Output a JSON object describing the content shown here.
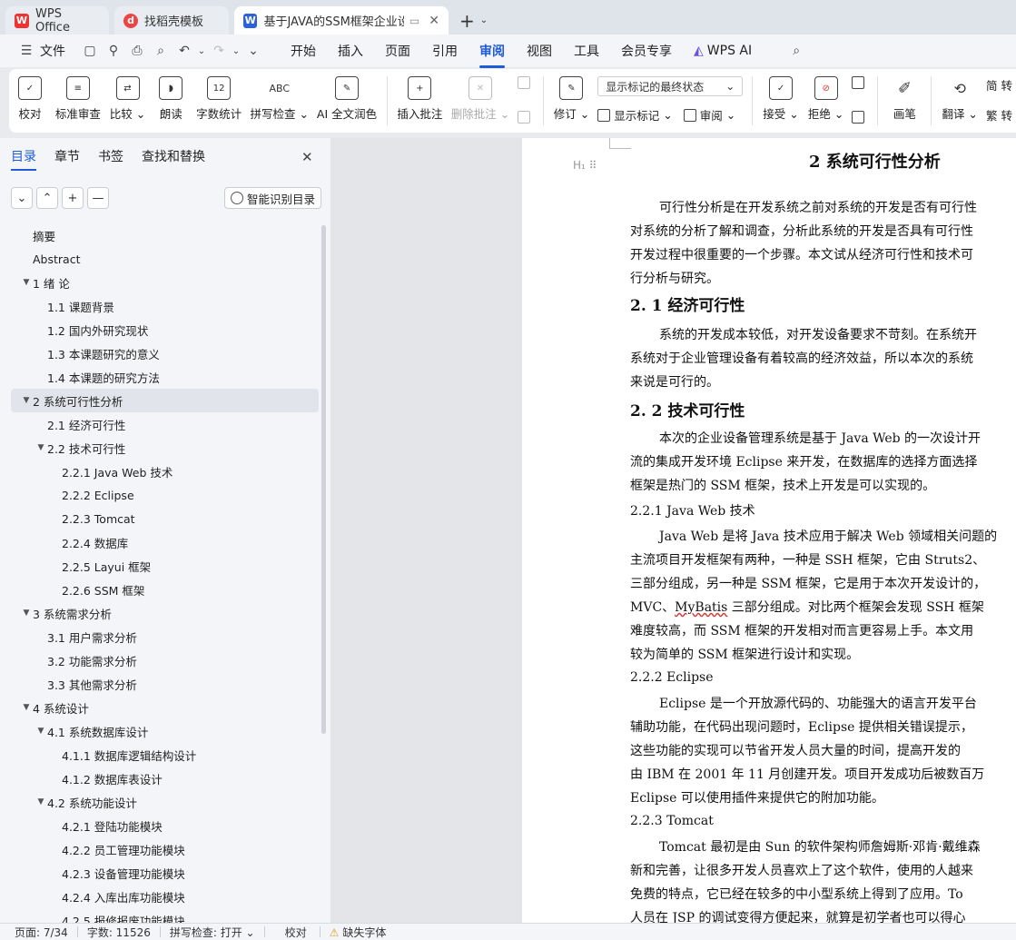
{
  "tabs": [
    {
      "label": "WPS Office",
      "icon": "wps-logo-icon"
    },
    {
      "label": "找稻壳模板",
      "icon": "docer-logo-icon"
    },
    {
      "label": "基于JAVA的SSM框架企业设备",
      "icon": "word-doc-icon"
    }
  ],
  "menubar": {
    "file": "文件",
    "items": [
      "开始",
      "插入",
      "页面",
      "引用",
      "审阅",
      "视图",
      "工具",
      "会员专享"
    ],
    "active": "审阅",
    "wps_ai": "WPS AI"
  },
  "ribbon": {
    "proofread": "校对",
    "std_review": "标准审查",
    "compare": "比较",
    "read_aloud": "朗读",
    "word_count": "字数统计",
    "word_count_icon": "12",
    "spell_check": "拼写检查",
    "spell_icon": "ABC",
    "ai_polish": "AI 全文润色",
    "insert_comment": "插入批注",
    "delete_comment": "删除批注",
    "track_changes": "修订",
    "markup_display": "显示标记的最终状态",
    "show_markup": "显示标记",
    "review": "审阅",
    "accept": "接受",
    "reject": "拒绝",
    "pen": "画笔",
    "translate": "翻译",
    "simp": "简",
    "trad": "繁"
  },
  "nav": {
    "tabs": [
      "目录",
      "章节",
      "书签",
      "查找和替换"
    ],
    "smart_btn": "智能识别目录",
    "toc": [
      {
        "label": "摘要",
        "level": 1,
        "arrow": false
      },
      {
        "label": "Abstract",
        "level": 1,
        "arrow": false
      },
      {
        "label": "1  绪  论",
        "level": 1,
        "arrow": true
      },
      {
        "label": "1.1  课题背景",
        "level": 2,
        "arrow": false
      },
      {
        "label": "1.2  国内外研究现状",
        "level": 2,
        "arrow": false
      },
      {
        "label": "1.3  本课题研究的意义",
        "level": 2,
        "arrow": false
      },
      {
        "label": "1.4  本课题的研究方法",
        "level": 2,
        "arrow": false
      },
      {
        "label": "2  系统可行性分析",
        "level": 1,
        "arrow": true,
        "selected": true
      },
      {
        "label": "2.1  经济可行性",
        "level": 2,
        "arrow": false
      },
      {
        "label": "2.2  技术可行性",
        "level": 2,
        "arrow": true
      },
      {
        "label": "2.2.1 Java Web 技术",
        "level": 3,
        "arrow": false
      },
      {
        "label": "2.2.2 Eclipse",
        "level": 3,
        "arrow": false
      },
      {
        "label": "2.2.3 Tomcat",
        "level": 3,
        "arrow": false
      },
      {
        "label": "2.2.4  数据库",
        "level": 3,
        "arrow": false
      },
      {
        "label": "2.2.5 Layui 框架",
        "level": 3,
        "arrow": false
      },
      {
        "label": "2.2.6 SSM 框架",
        "level": 3,
        "arrow": false
      },
      {
        "label": "3  系统需求分析",
        "level": 1,
        "arrow": true
      },
      {
        "label": "3.1  用户需求分析",
        "level": 2,
        "arrow": false
      },
      {
        "label": "3.2  功能需求分析",
        "level": 2,
        "arrow": false
      },
      {
        "label": "3.3  其他需求分析",
        "level": 2,
        "arrow": false
      },
      {
        "label": "4  系统设计",
        "level": 1,
        "arrow": true
      },
      {
        "label": "4.1  系统数据库设计",
        "level": 2,
        "arrow": true
      },
      {
        "label": "4.1.1  数据库逻辑结构设计",
        "level": 3,
        "arrow": false
      },
      {
        "label": "4.1.2  数据库表设计",
        "level": 3,
        "arrow": false
      },
      {
        "label": "4.2  系统功能设计",
        "level": 2,
        "arrow": true
      },
      {
        "label": "4.2.1  登陆功能模块",
        "level": 3,
        "arrow": false
      },
      {
        "label": "4.2.2  员工管理功能模块",
        "level": 3,
        "arrow": false
      },
      {
        "label": "4.2.3  设备管理功能模块",
        "level": 3,
        "arrow": false
      },
      {
        "label": "4.2.4  入库出库功能模块",
        "level": 3,
        "arrow": false
      },
      {
        "label": "4.2.5  报修报废功能模块",
        "level": 3,
        "arrow": false
      }
    ]
  },
  "doc": {
    "heading_marker": "H₁",
    "h1": "2  系统可行性分析",
    "p1": [
      "可行性分析是在开发系统之前对系统的开发是否有可行性",
      "对系统的分析了解和调查，分析此系统的开发是否具有可行性",
      "开发过程中很重要的一个步骤。本文试从经济可行性和技术可",
      "行分析与研究。"
    ],
    "h2_1": "2. 1  经济可行性",
    "p2": [
      "系统的开发成本较低，对开发设备要求不苛刻。在系统开",
      "系统对于企业管理设备有着较高的经济效益，所以本次的系统",
      "来说是可行的。"
    ],
    "h2_2": "2. 2  技术可行性",
    "p3": [
      "本次的企业设备管理系统是基于 Java Web 的一次设计开",
      "流的集成开发环境 Eclipse 来开发，在数据库的选择方面选择",
      "框架是热门的 SSM 框架，技术上开发是可以实现的。"
    ],
    "h3_1": "2.2.1 Java Web 技术",
    "p4": [
      "Java Web 是将 Java 技术应用于解决 Web 领域相关问题的",
      "主流项目开发框架有两种，一种是 SSH 框架，它由 Struts2、",
      "三部分组成，另一种是 SSM 框架，它是用于本次开发设计的，",
      "MVC、",
      "MyBatis",
      " 三部分组成。对比两个框架会发现 SSH 框架",
      "难度较高，而 SSM 框架的开发相对而言更容易上手。本文用",
      "较为简单的 SSM 框架进行设计和实现。"
    ],
    "h3_2": "2.2.2 Eclipse",
    "p5": [
      "Eclipse  是一个开放源代码的、功能强大的语言开发平台",
      "辅助功能，在代码出现问题时，Eclipse 提供相关错误提示，",
      "这些功能的实现可以节省开发人员大量的时间，提高开发的",
      "由 IBM 在 2001 年 11 月创建开发。项目开发成功后被数百万",
      "Eclipse 可以使用插件来提供它的附加功能。"
    ],
    "h3_3": "2.2.3 Tomcat",
    "p6": [
      "Tomcat 最初是由 Sun 的软件架构师詹姆斯·邓肯·戴维森",
      "新和完善，让很多开发人员喜欢上了这个软件，使用的人越来",
      "免费的特点，它已经在较多的中小型系统上得到了应用。To",
      "人员在 JSP 的调试变得方便起来，就算是初学者也可以得心"
    ]
  },
  "status": {
    "page": "页面: 7/34",
    "words": "字数: 11526",
    "spell": "拼写检查: 打开",
    "proof": "校对",
    "missing_font": "缺失字体"
  }
}
